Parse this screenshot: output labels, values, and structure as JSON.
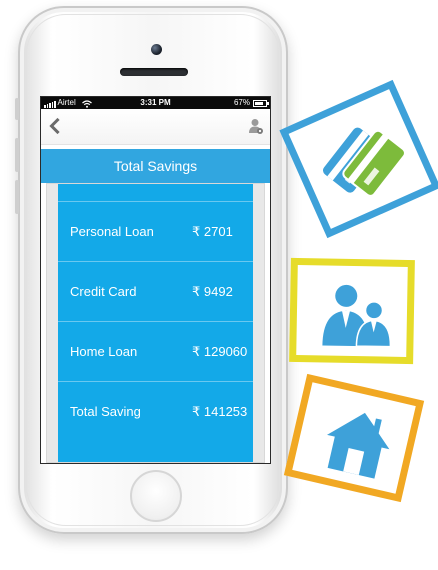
{
  "status_bar": {
    "carrier": "Airtel",
    "time": "3:31 PM",
    "battery": "67%"
  },
  "nav": {
    "back_icon": "chevron-left-icon",
    "profile_icon": "user-settings-icon"
  },
  "screen_title": "Total Savings",
  "savings": [
    {
      "label": "Personal Loan",
      "value": "₹ 2701"
    },
    {
      "label": "Credit Card",
      "value": "₹ 9492"
    },
    {
      "label": "Home Loan",
      "value": "₹ 129060"
    },
    {
      "label": "Total Saving",
      "value": "₹ 141253"
    }
  ],
  "illustrations": [
    "credit-cards-icon",
    "people-icon",
    "house-icon"
  ],
  "colors": {
    "title_bar": "#31a6e0",
    "list_background": "#13a9e8",
    "frame_blue": "#3ea1d9",
    "frame_yellow": "#e6dc2a",
    "frame_orange": "#f1a823",
    "card_green": "#7dbb3b"
  }
}
